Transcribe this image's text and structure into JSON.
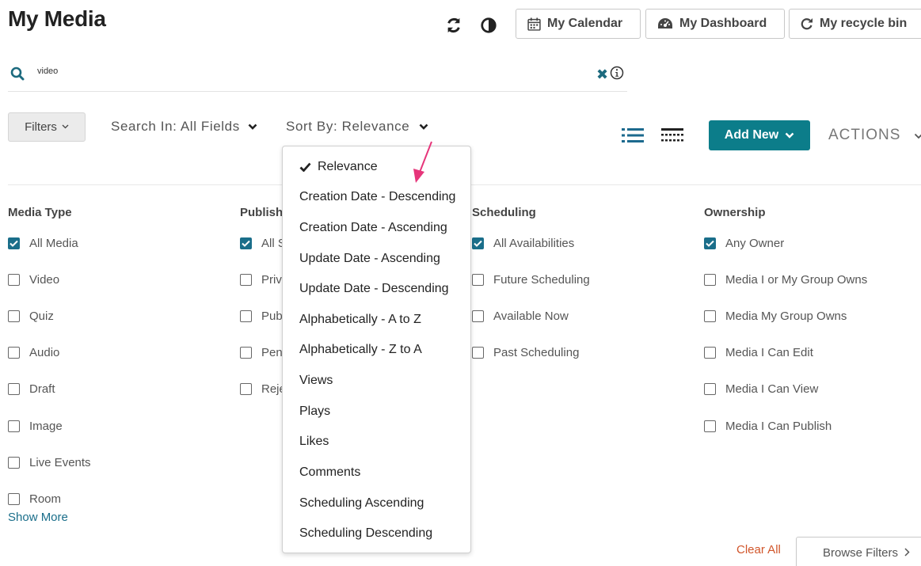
{
  "page": {
    "title": "My Media"
  },
  "header": {
    "refresh_icon": "refresh-icon",
    "contrast_icon": "contrast-icon",
    "calendar_label": "My Calendar",
    "dashboard_label": "My Dashboard",
    "recycle_label": "My recycle bin"
  },
  "search": {
    "value": "video",
    "placeholder": ""
  },
  "toolbar": {
    "filters_label": "Filters",
    "search_in_label": "Search In: All Fields",
    "sort_by_label": "Sort By: Relevance",
    "add_new_label": "Add New",
    "actions_label": "ACTIONS"
  },
  "filters": {
    "media_type": {
      "title": "Media Type",
      "options": [
        {
          "label": "All Media",
          "checked": true
        },
        {
          "label": "Video",
          "checked": false
        },
        {
          "label": "Quiz",
          "checked": false
        },
        {
          "label": "Audio",
          "checked": false
        },
        {
          "label": "Draft",
          "checked": false
        },
        {
          "label": "Image",
          "checked": false
        },
        {
          "label": "Live Events",
          "checked": false
        },
        {
          "label": "Room",
          "checked": false
        }
      ]
    },
    "publish": {
      "title": "Publish",
      "options": [
        {
          "label": "All S",
          "checked": true
        },
        {
          "label": "Priv",
          "checked": false
        },
        {
          "label": "Pub",
          "checked": false
        },
        {
          "label": "Pen",
          "checked": false
        },
        {
          "label": "Reje",
          "checked": false
        }
      ]
    },
    "scheduling": {
      "title": "Scheduling",
      "options": [
        {
          "label": "All Availabilities",
          "checked": true
        },
        {
          "label": "Future Scheduling",
          "checked": false
        },
        {
          "label": "Available Now",
          "checked": false
        },
        {
          "label": "Past Scheduling",
          "checked": false
        }
      ]
    },
    "ownership": {
      "title": "Ownership",
      "options": [
        {
          "label": "Any Owner",
          "checked": true
        },
        {
          "label": "Media I or My Group Owns",
          "checked": false
        },
        {
          "label": "Media My Group Owns",
          "checked": false
        },
        {
          "label": "Media I Can Edit",
          "checked": false
        },
        {
          "label": "Media I Can View",
          "checked": false
        },
        {
          "label": "Media I Can Publish",
          "checked": false
        }
      ]
    },
    "show_more_label": "Show More",
    "clear_all_label": "Clear All",
    "browse_filters_label": "Browse Filters"
  },
  "sort_dropdown": {
    "selected": "Relevance",
    "items": [
      "Relevance",
      "Creation Date - Descending",
      "Creation Date - Ascending",
      "Update Date - Ascending",
      "Update Date - Descending",
      "Alphabetically - A to Z",
      "Alphabetically - Z to A",
      "Views",
      "Plays",
      "Likes",
      "Comments",
      "Scheduling Ascending",
      "Scheduling Descending"
    ]
  },
  "colors": {
    "accent": "#0c7d8a",
    "checkbox": "#1a6e8a",
    "clear": "#d1562b",
    "arrow": "#e6357a"
  }
}
